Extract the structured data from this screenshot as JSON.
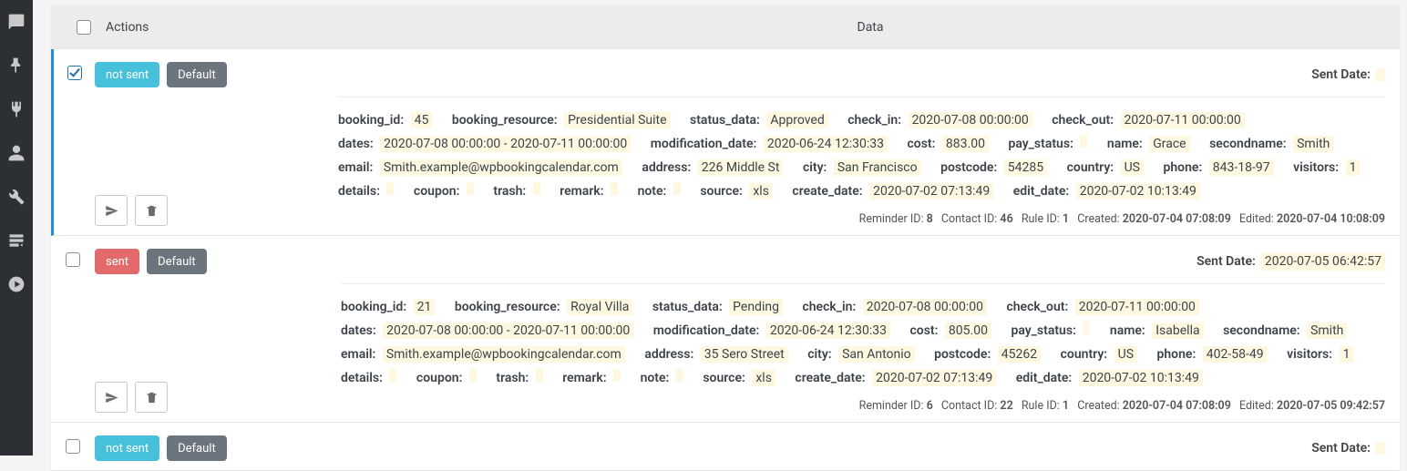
{
  "header": {
    "actions": "Actions",
    "data": "Data"
  },
  "labels": {
    "sent_date": "Sent Date",
    "reminder_id": "Reminder ID:",
    "contact_id": "Contact ID:",
    "rule_id": "Rule ID:",
    "created": "Created:",
    "edited": "Edited:"
  },
  "badge": {
    "not_sent": "not sent",
    "sent": "sent",
    "default": "Default"
  },
  "field_keys": {
    "booking_id": "booking_id",
    "booking_resource": "booking_resource",
    "status_data": "status_data",
    "check_in": "check_in",
    "check_out": "check_out",
    "dates": "dates",
    "modification_date": "modification_date",
    "cost": "cost",
    "pay_status": "pay_status",
    "name": "name",
    "secondname": "secondname",
    "email": "email",
    "address": "address",
    "city": "city",
    "postcode": "postcode",
    "country": "country",
    "phone": "phone",
    "visitors": "visitors",
    "details": "details",
    "coupon": "coupon",
    "trash": "trash",
    "remark": "remark",
    "note": "note",
    "source": "source",
    "create_date": "create_date",
    "edit_date": "edit_date"
  },
  "rows": [
    {
      "checked": true,
      "status_badge": "not_sent",
      "sent_date": "",
      "meta": {
        "reminder_id": "8",
        "contact_id": "46",
        "rule_id": "1",
        "created": "2020-07-04 07:08:09",
        "edited": "2020-07-04 10:08:09"
      },
      "fields": {
        "booking_id": "45",
        "booking_resource": "Presidential Suite",
        "status_data": "Approved",
        "check_in": "2020-07-08 00:00:00",
        "check_out": "2020-07-11 00:00:00",
        "dates": "2020-07-08 00:00:00 - 2020-07-11 00:00:00",
        "modification_date": "2020-06-24 12:30:33",
        "cost": "883.00",
        "pay_status": "",
        "name": "Grace",
        "secondname": "Smith",
        "email": "Smith.example@wpbookingcalendar.com",
        "address": "226 Middle St",
        "city": "San Francisco",
        "postcode": "54285",
        "country": "US",
        "phone": "843-18-97",
        "visitors": "1",
        "details": "",
        "coupon": "",
        "trash": "",
        "remark": "",
        "note": "",
        "source": "xls",
        "create_date": "2020-07-02 07:13:49",
        "edit_date": "2020-07-02 10:13:49"
      }
    },
    {
      "checked": false,
      "status_badge": "sent",
      "sent_date": "2020-07-05 06:42:57",
      "meta": {
        "reminder_id": "6",
        "contact_id": "22",
        "rule_id": "1",
        "created": "2020-07-04 07:08:09",
        "edited": "2020-07-05 09:42:57"
      },
      "fields": {
        "booking_id": "21",
        "booking_resource": "Royal Villa",
        "status_data": "Pending",
        "check_in": "2020-07-08 00:00:00",
        "check_out": "2020-07-11 00:00:00",
        "dates": "2020-07-08 00:00:00 - 2020-07-11 00:00:00",
        "modification_date": "2020-06-24 12:30:33",
        "cost": "805.00",
        "pay_status": "",
        "name": "Isabella",
        "secondname": "Smith",
        "email": "Smith.example@wpbookingcalendar.com",
        "address": "35 Sero Street",
        "city": "San Antonio",
        "postcode": "45262",
        "country": "US",
        "phone": "402-58-49",
        "visitors": "1",
        "details": "",
        "coupon": "",
        "trash": "",
        "remark": "",
        "note": "",
        "source": "xls",
        "create_date": "2020-07-02 07:13:49",
        "edit_date": "2020-07-02 10:13:49"
      }
    },
    {
      "checked": false,
      "status_badge": "not_sent",
      "sent_date": "",
      "meta": null,
      "fields": null
    }
  ]
}
